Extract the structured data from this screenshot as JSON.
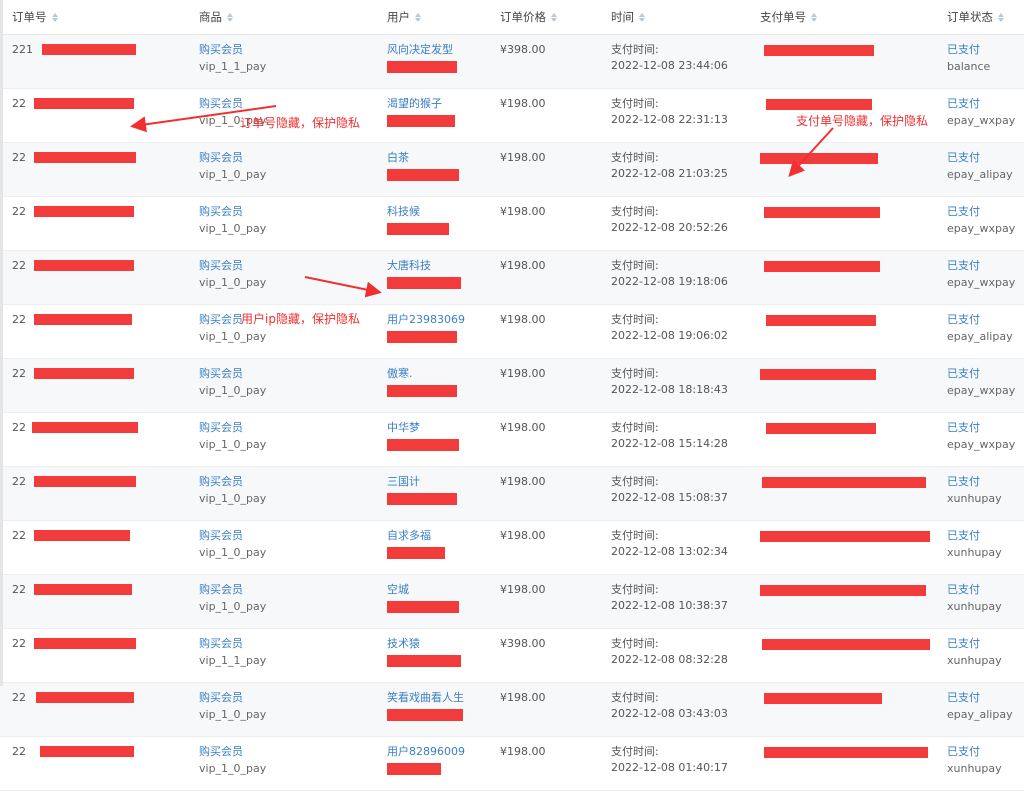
{
  "columns": [
    "订单号",
    "商品",
    "用户",
    "订单价格",
    "时间",
    "支付单号",
    "订单状态"
  ],
  "pay_time_label": "支付时间:",
  "rows": [
    {
      "order_prefix": "221",
      "product": "购买会员",
      "sku": "vip_1_1_pay",
      "user": "风向决定发型",
      "price": "¥398.00",
      "time": "2022-12-08 23:44:06",
      "status": "已支付",
      "method": "balance"
    },
    {
      "order_prefix": "22",
      "product": "购买会员",
      "sku": "vip_1_0_pay",
      "user": "渴望的猴子",
      "price": "¥198.00",
      "time": "2022-12-08 22:31:13",
      "status": "已支付",
      "method": "epay_wxpay"
    },
    {
      "order_prefix": "22",
      "product": "购买会员",
      "sku": "vip_1_0_pay",
      "user": "白茶",
      "price": "¥198.00",
      "time": "2022-12-08 21:03:25",
      "status": "已支付",
      "method": "epay_alipay"
    },
    {
      "order_prefix": "22",
      "product": "购买会员",
      "sku": "vip_1_0_pay",
      "user": "科技候",
      "price": "¥198.00",
      "time": "2022-12-08 20:52:26",
      "status": "已支付",
      "method": "epay_wxpay"
    },
    {
      "order_prefix": "22",
      "product": "购买会员",
      "sku": "vip_1_0_pay",
      "user": "大唐科技",
      "price": "¥198.00",
      "time": "2022-12-08 19:18:06",
      "status": "已支付",
      "method": "epay_wxpay"
    },
    {
      "order_prefix": "22",
      "product": "购买会员",
      "sku": "vip_1_0_pay",
      "user": "用户23983069",
      "price": "¥198.00",
      "time": "2022-12-08 19:06:02",
      "status": "已支付",
      "method": "epay_alipay"
    },
    {
      "order_prefix": "22",
      "product": "购买会员",
      "sku": "vip_1_0_pay",
      "user": "傲寒.",
      "price": "¥198.00",
      "time": "2022-12-08 18:18:43",
      "status": "已支付",
      "method": "epay_wxpay"
    },
    {
      "order_prefix": "22",
      "product": "购买会员",
      "sku": "vip_1_0_pay",
      "user": "中华梦",
      "price": "¥198.00",
      "time": "2022-12-08 15:14:28",
      "status": "已支付",
      "method": "epay_wxpay"
    },
    {
      "order_prefix": "22",
      "product": "购买会员",
      "sku": "vip_1_0_pay",
      "user": "三国计",
      "price": "¥198.00",
      "time": "2022-12-08 15:08:37",
      "status": "已支付",
      "method": "xunhupay"
    },
    {
      "order_prefix": "22",
      "product": "购买会员",
      "sku": "vip_1_0_pay",
      "user": "自求多福",
      "price": "¥198.00",
      "time": "2022-12-08 13:02:34",
      "status": "已支付",
      "method": "xunhupay"
    },
    {
      "order_prefix": "22",
      "product": "购买会员",
      "sku": "vip_1_0_pay",
      "user": "空城",
      "price": "¥198.00",
      "time": "2022-12-08 10:38:37",
      "status": "已支付",
      "method": "xunhupay"
    },
    {
      "order_prefix": "22",
      "product": "购买会员",
      "sku": "vip_1_1_pay",
      "user": "技术猿",
      "price": "¥398.00",
      "time": "2022-12-08 08:32:28",
      "status": "已支付",
      "method": "xunhupay"
    },
    {
      "order_prefix": "22",
      "product": "购买会员",
      "sku": "vip_1_0_pay",
      "user": "笑看戏曲看人生",
      "price": "¥198.00",
      "time": "2022-12-08 03:43:03",
      "status": "已支付",
      "method": "epay_alipay"
    },
    {
      "order_prefix": "22",
      "product": "购买会员",
      "sku": "vip_1_0_pay",
      "user": "用户82896009",
      "price": "¥198.00",
      "time": "2022-12-08 01:40:17",
      "status": "已支付",
      "method": "xunhupay"
    }
  ],
  "annotations": {
    "order_hidden": "订单号隐藏，保护隐私",
    "pay_hidden": "支付单号隐藏，保护隐私",
    "ip_hidden": "用户ip隐藏，保护隐私"
  },
  "colors": {
    "link": "#3a7fc4",
    "redaction": "#f23b3b",
    "annotation": "#f03030"
  }
}
